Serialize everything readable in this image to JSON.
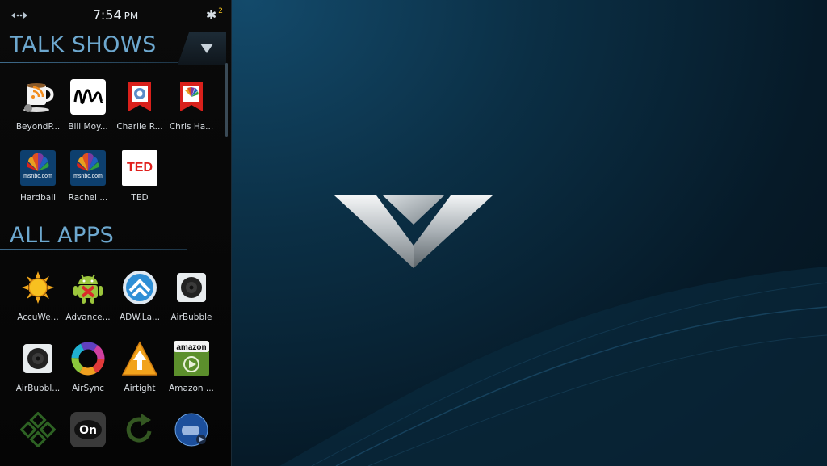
{
  "status": {
    "time": "7:54",
    "ampm": "PM",
    "notification_count": "2"
  },
  "sections": {
    "talk_shows": {
      "title": "TALK SHOWS",
      "apps": [
        {
          "label": "BeyondP...",
          "icon": "coffee-cup-icon"
        },
        {
          "label": "Bill Moy...",
          "icon": "signature-icon"
        },
        {
          "label": "Charlie R...",
          "icon": "charlie-rose-icon"
        },
        {
          "label": "Chris Ha...",
          "icon": "nbc-peacock-bookmark-icon"
        },
        {
          "label": "Hardball",
          "icon": "msnbc-icon"
        },
        {
          "label": "Rachel ...",
          "icon": "msnbc-icon"
        },
        {
          "label": "TED",
          "icon": "ted-icon",
          "text": "TED"
        }
      ]
    },
    "all_apps": {
      "title": "ALL APPS",
      "apps": [
        {
          "label": "AccuWe...",
          "icon": "sun-icon"
        },
        {
          "label": "Advance...",
          "icon": "android-icon"
        },
        {
          "label": "ADW.La...",
          "icon": "adw-launcher-icon"
        },
        {
          "label": "AirBubble",
          "icon": "speaker-icon"
        },
        {
          "label": "AirBubbl...",
          "icon": "speaker-icon"
        },
        {
          "label": "AirSync",
          "icon": "color-ring-icon"
        },
        {
          "label": "Airtight",
          "icon": "warning-arrow-icon"
        },
        {
          "label": "Amazon ...",
          "icon": "amazon-mp3-icon"
        },
        {
          "label": "",
          "icon": "puzzle-cross-icon"
        },
        {
          "label": "",
          "icon": "aol-on-icon",
          "text": "On"
        },
        {
          "label": "",
          "icon": "refresh-arrow-icon"
        },
        {
          "label": "",
          "icon": "gamepad-globe-icon"
        }
      ]
    }
  },
  "amazon_text": "amazon",
  "msnbc_text": "msnbc.com",
  "colors": {
    "section_title": "#6da8cf",
    "background": "#0b2f45",
    "panel": "#050505"
  }
}
